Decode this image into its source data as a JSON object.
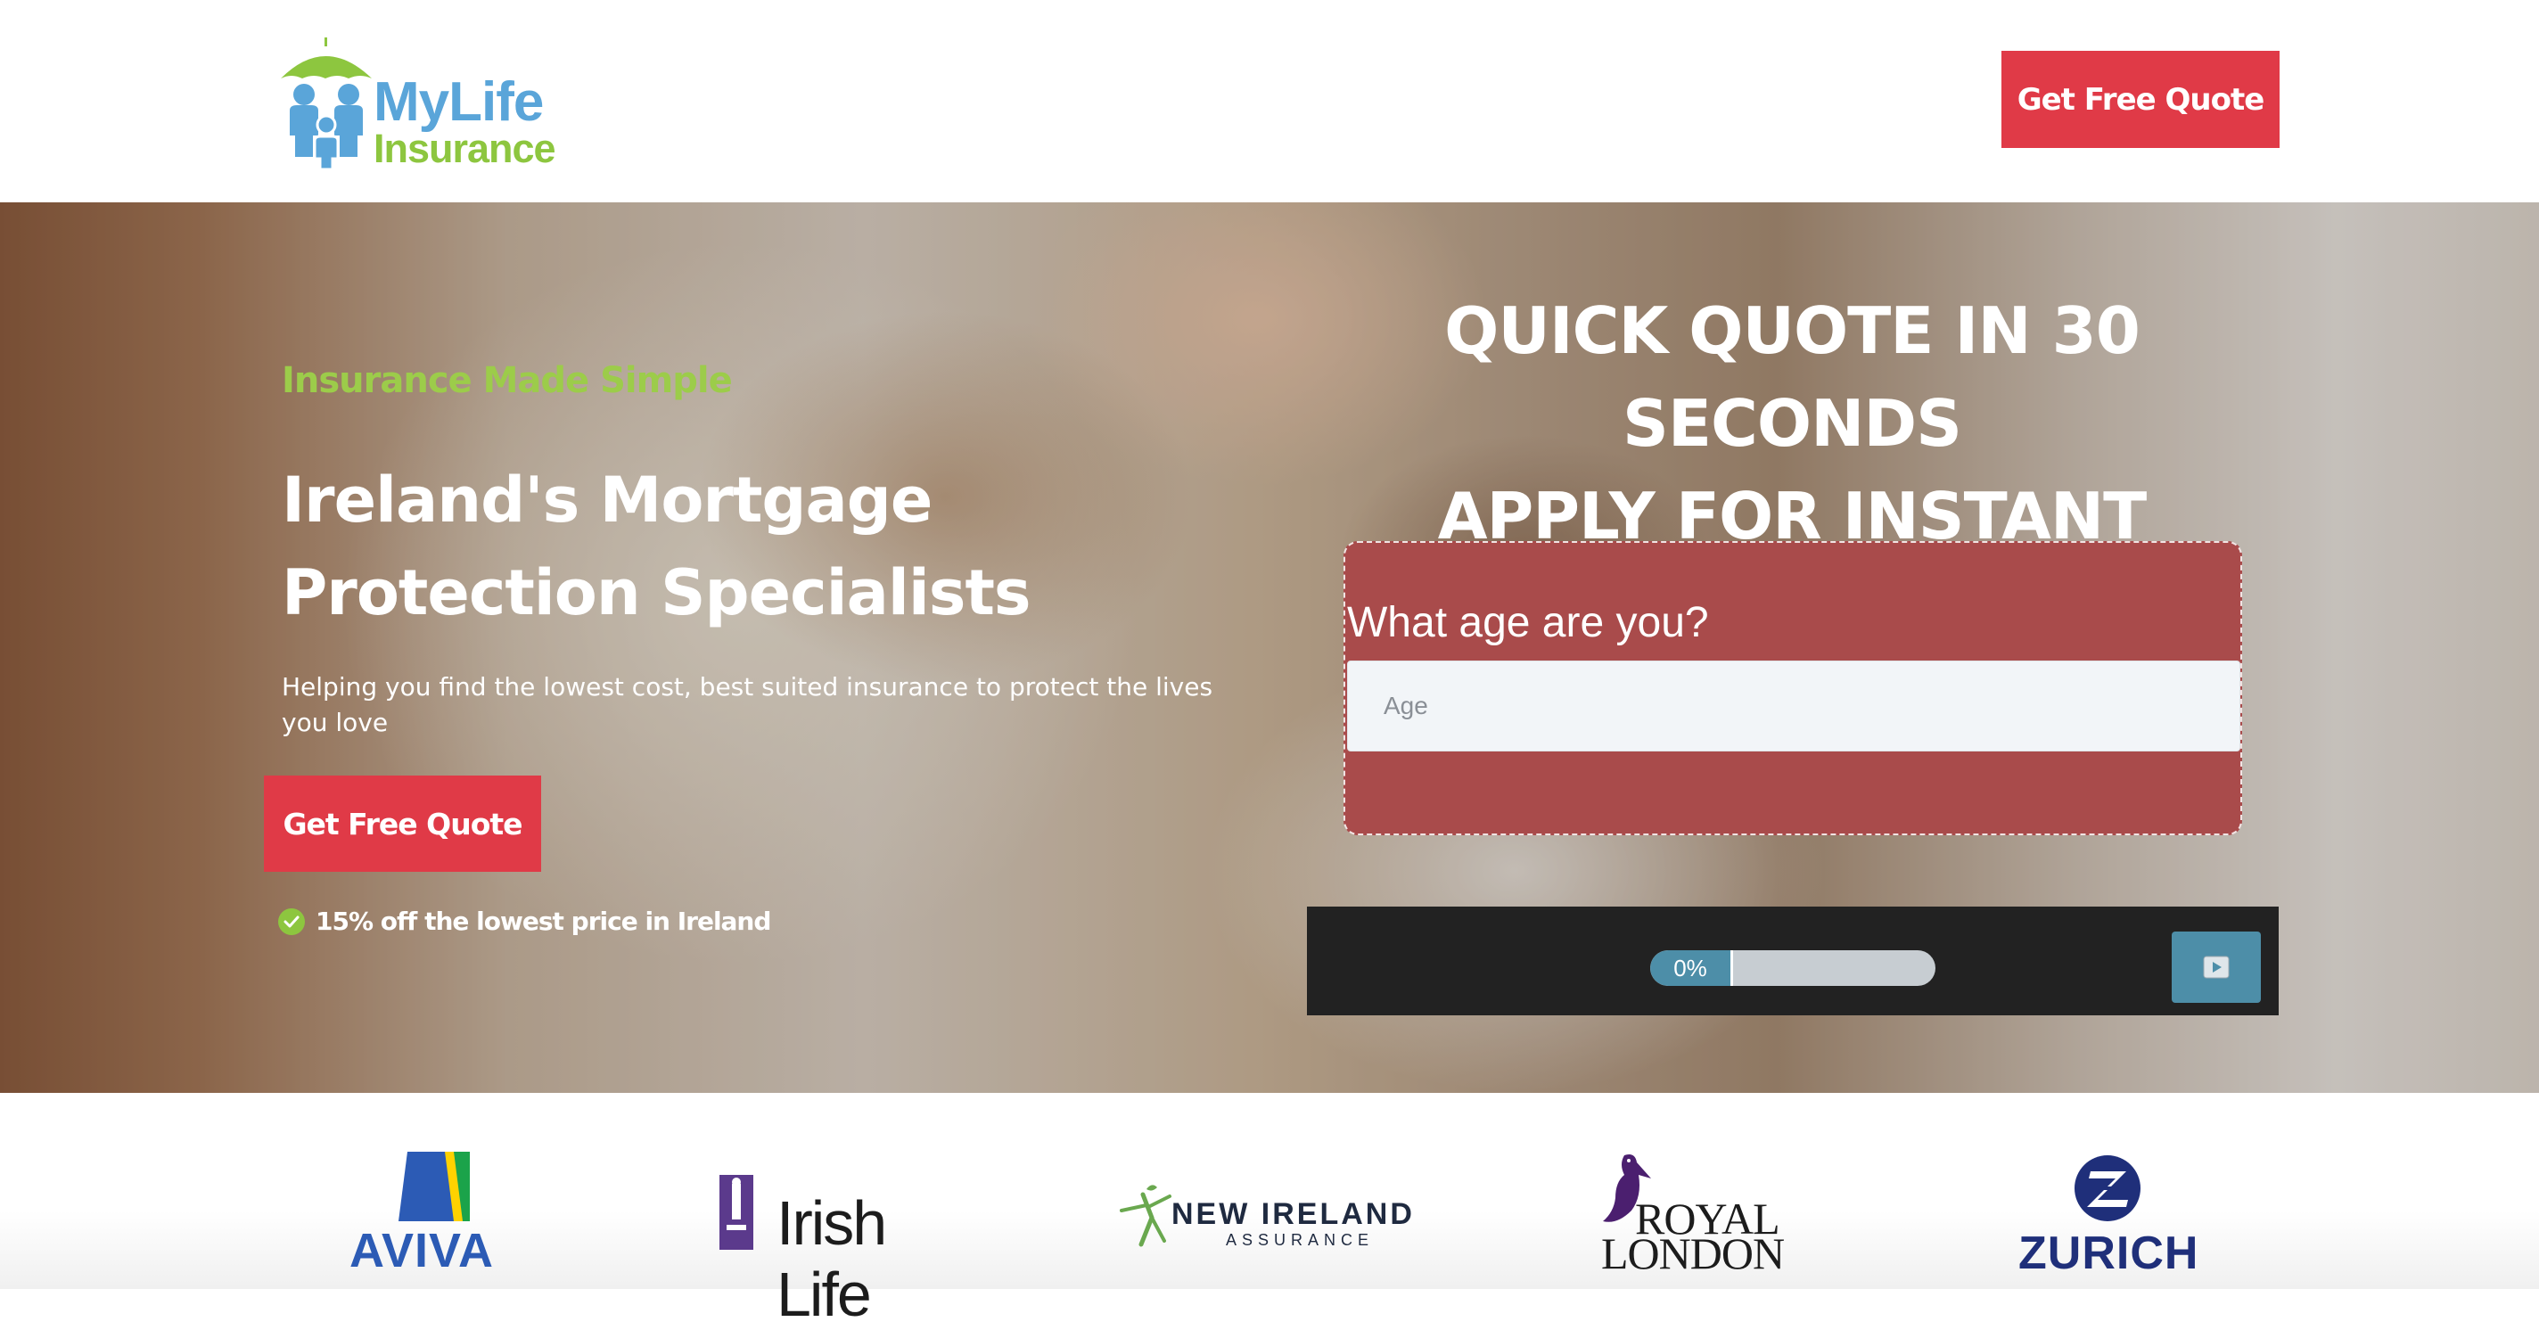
{
  "header": {
    "logo": {
      "line1": "MyLife",
      "line2": "Insurance"
    },
    "cta_label": "Get Free Quote"
  },
  "hero": {
    "eyebrow": "Insurance Made Simple",
    "title": "Ireland's Mortgage Protection Specialists",
    "subtitle": "Helping you find the lowest cost, best suited insurance to protect the lives you love",
    "cta_label": "Get Free Quote",
    "usp": "15% off the lowest price in Ireland"
  },
  "quote": {
    "heading_line1": "QUICK QUOTE IN 30 SECONDS",
    "heading_line2": "APPLY FOR INSTANT COVER",
    "question": "What age are you?",
    "age_placeholder": "Age",
    "age_value": ""
  },
  "player": {
    "progress_label": "0%",
    "progress_fraction": 0,
    "play_icon": "play-icon"
  },
  "partners": {
    "aviva": "AVIVA",
    "irish_life": "Irish Life",
    "new_ireland_line1": "NEW IRELAND",
    "new_ireland_line2": "ASSURANCE",
    "royal_london_line1": "ROYAL",
    "royal_london_line2": "LONDON",
    "zurich": "ZURICH"
  },
  "colors": {
    "brand_red": "#e03a47",
    "brand_green": "#8dc63f",
    "brand_blue": "#5aa5d9",
    "form_card": "#a94b4b",
    "player_bg": "#222222",
    "player_accent": "#4d8ea8"
  }
}
